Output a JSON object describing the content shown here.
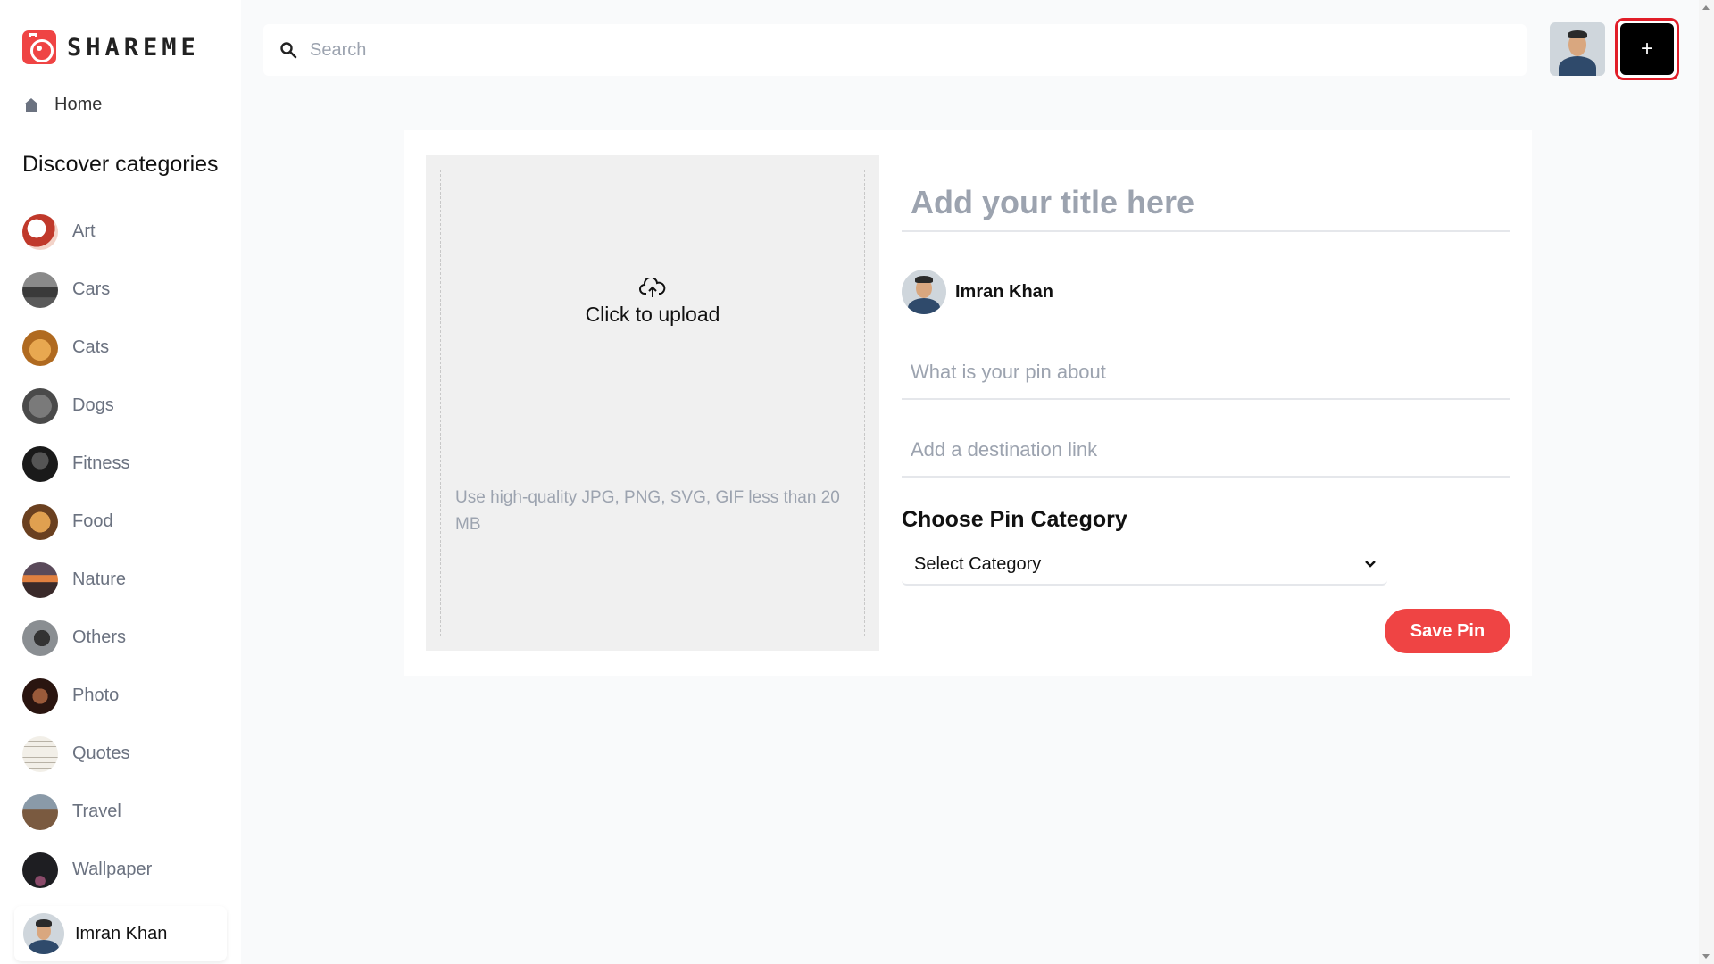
{
  "app": {
    "logo_text": "SHAREME",
    "brand_color": "#ef4444"
  },
  "sidebar": {
    "home_label": "Home",
    "discover_heading": "Discover categories",
    "categories": [
      {
        "label": "Art",
        "thumb_color": "#c0392b"
      },
      {
        "label": "Cars",
        "thumb_color": "#4a4a4a"
      },
      {
        "label": "Cats",
        "thumb_color": "#c98a3a"
      },
      {
        "label": "Dogs",
        "thumb_color": "#6b6b6b"
      },
      {
        "label": "Fitness",
        "thumb_color": "#2b2b2b"
      },
      {
        "label": "Food",
        "thumb_color": "#a8692e"
      },
      {
        "label": "Nature",
        "thumb_color": "#c4663a"
      },
      {
        "label": "Others",
        "thumb_color": "#555a5e"
      },
      {
        "label": "Photo",
        "thumb_color": "#5a2f1e"
      },
      {
        "label": "Quotes",
        "thumb_color": "#e8e4da"
      },
      {
        "label": "Travel",
        "thumb_color": "#7a6a5a"
      },
      {
        "label": "Wallpaper",
        "thumb_color": "#2f2f35"
      }
    ],
    "profile_name": "Imran Khan"
  },
  "topbar": {
    "search_placeholder": "Search",
    "add_button_label": "+"
  },
  "form": {
    "upload_prompt": "Click to upload",
    "upload_hint": "Use high-quality JPG, PNG, SVG, GIF less than 20 MB",
    "title_placeholder": "Add your title here",
    "author_name": "Imran Khan",
    "about_placeholder": "What is your pin about",
    "destination_placeholder": "Add a destination link",
    "category_heading": "Choose Pin Category",
    "category_selected": "Select Category",
    "save_label": "Save Pin"
  }
}
